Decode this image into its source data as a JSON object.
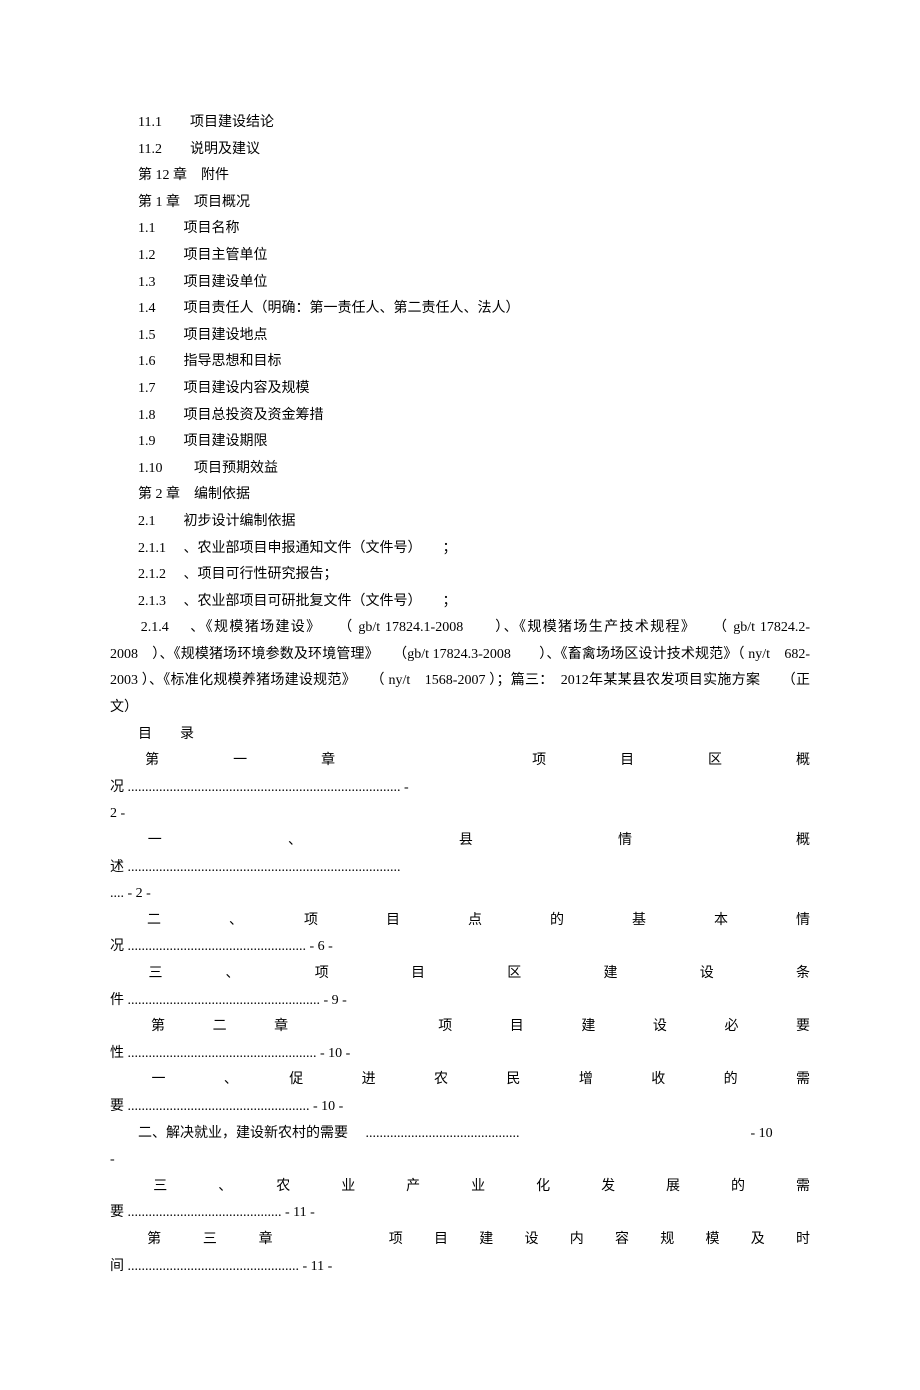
{
  "lines": {
    "l1": "11.1　　项目建设结论",
    "l2": "11.2　　说明及建议",
    "l3": "　　第 12 章　附件",
    "l4": "　　第 1 章　项目概况",
    "l5": "1.1　　项目名称",
    "l6": "1.2　　项目主管单位",
    "l7": "1.3　　项目建设单位",
    "l8": "1.4　　项目责任人（明确：第一责任人、第二责任人、法人）",
    "l9": "1.5　　项目建设地点",
    "l10": "1.6　　指导思想和目标",
    "l11": "1.7　　项目建设内容及规模",
    "l12": "1.8　　项目总投资及资金筹措",
    "l13": "1.9　　项目建设期限",
    "l14": "1.10　　 项目预期效益",
    "l15": "　　第 2 章　编制依据",
    "l16": "2.1　　初步设计编制依据",
    "l17": "2.1.1　 、农业部项目申报通知文件（文件号）　　；",
    "l18": "2.1.2　 、项目可行性研究报告；",
    "l19": "2.1.3　 、农业部项目可研批复文件（文件号）　　；"
  },
  "para1": "　　2.1.4　 、《规模猪场建设》　　（ gb/t 17824.1-2008　　）、《规模猪场生产技术规程》　　（ gb/t 17824.2-2008　）、《规模猪场环境参数及环境管理》　　（gb/t 17824.3-2008　　）、《畜禽场场区设计技术规范》（ ny/t　682-2003 ）、《标准化规模养猪场建设规范》　　（ ny/t　1568-2007 ）；篇三：　2012年某某县农发项目实施方案　　（正文）",
  "mulu": "　　目　　录",
  "toc": {
    "t1a": "　　第　　　　一　　　　章　　　　　　　　　　　项　　　　目　　　　区　　　　概",
    "t1b": "况 .............................................................................. -",
    "t1c": "2 -",
    "t2a": "　　一　　　　　　 、　　　　　　　　 县　　　　　　　 情　　　　　　　　 概",
    "t2b": "述 ..............................................................................",
    "t2c": ".... - 2 -",
    "t3a": "　　二　　　 、　　　 项　　　 目　　　 点　　　 的　　　 基　　　 本　　　 情",
    "t3b": "况 ................................................... - 6 -",
    "t4a": "　　三　　　、　　　　项　　　　目　　　　区　　　　建　　　　设　　　　条",
    "t4b": "件 ....................................................... - 9 -",
    "t5a": "　　第　　二　　章　　　　　　　项　　 目　　 建　　 设　　 必　　 要",
    "t5b": "性 ...................................................... - 10 -",
    "t6a": "　　一　　 、　　 促　　 进　　 农　　 民　　 增　　 收　　 的　　 需",
    "t6b": "要 .................................................... - 10 -",
    "t7a": "　　二、解决就业，建设新农村的需要　 ............................................",
    "t7b": "　　　　　　　　　　　　　　　　 - 10",
    "t7c": "-",
    "t8a": "　　三　　、　　农　　业　　产　　业　　化　　发　　展　　的　　需",
    "t8b": "要 ............................................ - 11 -",
    "t9a": "　　第　　三　　章　　　　　　项　 目　 建　 设　 内　 容　 规　 模　 及　 时",
    "t9b": "间 ................................................. - 11 -"
  }
}
